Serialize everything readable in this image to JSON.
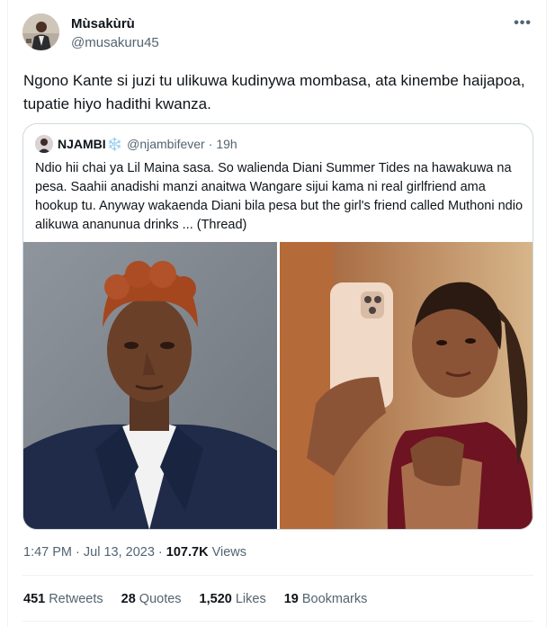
{
  "tweet": {
    "author_name": "Mùsakùrù",
    "author_handle": "@musakuru45",
    "more_icon": "•••",
    "text": "Ngono Kante si juzi tu ulikuwa kudinywa mombasa, ata kinembe haijapoa, tupatie hiyo hadithi kwanza.",
    "timestamp": "1:47 PM · Jul 13, 2023 ·",
    "views_count": "107.7K",
    "views_label": "Views"
  },
  "quote": {
    "author_name": "NJAMBI",
    "snow_icon": "❄️",
    "author_handle": "@njambifever",
    "dot": "·",
    "time": "19h",
    "text": "Ndio hii chai ya Lil Maina sasa. So walienda Diani Summer Tides na hawakuwa na pesa. Saahii anadishi manzi anaitwa Wangare sijui kama ni real girlfriend ama hookup tu. Anyway wakaenda Diani bila pesa but the girl's friend called Muthoni ndio alikuwa ananunua drinks ... (Thread)"
  },
  "stats": {
    "retweets_count": "451",
    "retweets_label": "Retweets",
    "quotes_count": "28",
    "quotes_label": "Quotes",
    "likes_count": "1,520",
    "likes_label": "Likes",
    "bookmarks_count": "19",
    "bookmarks_label": "Bookmarks"
  }
}
